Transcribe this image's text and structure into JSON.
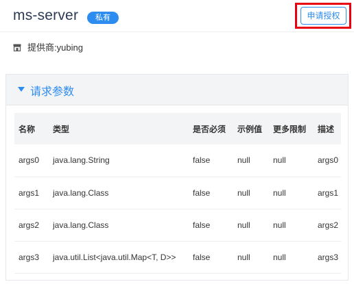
{
  "header": {
    "title": "ms-server",
    "badge": "私有",
    "apply_button": "申请授权"
  },
  "provider": {
    "text": "提供商:yubing",
    "icon": "store-icon"
  },
  "panel": {
    "title": "请求参数",
    "columns": [
      "名称",
      "类型",
      "是否必须",
      "示例值",
      "更多限制",
      "描述"
    ],
    "rows": [
      [
        "args0",
        "java.lang.String",
        "false",
        "null",
        "null",
        "args0"
      ],
      [
        "args1",
        "java.lang.Class",
        "false",
        "null",
        "null",
        "args1"
      ],
      [
        "args2",
        "java.lang.Class",
        "false",
        "null",
        "null",
        "args2"
      ],
      [
        "args3",
        "java.util.List<java.util.Map<T, D>>",
        "false",
        "null",
        "null",
        "args3"
      ]
    ]
  },
  "colors": {
    "accent": "#2d8cf0",
    "highlight": "#e60012",
    "panel_bg": "#f3f4f6"
  }
}
